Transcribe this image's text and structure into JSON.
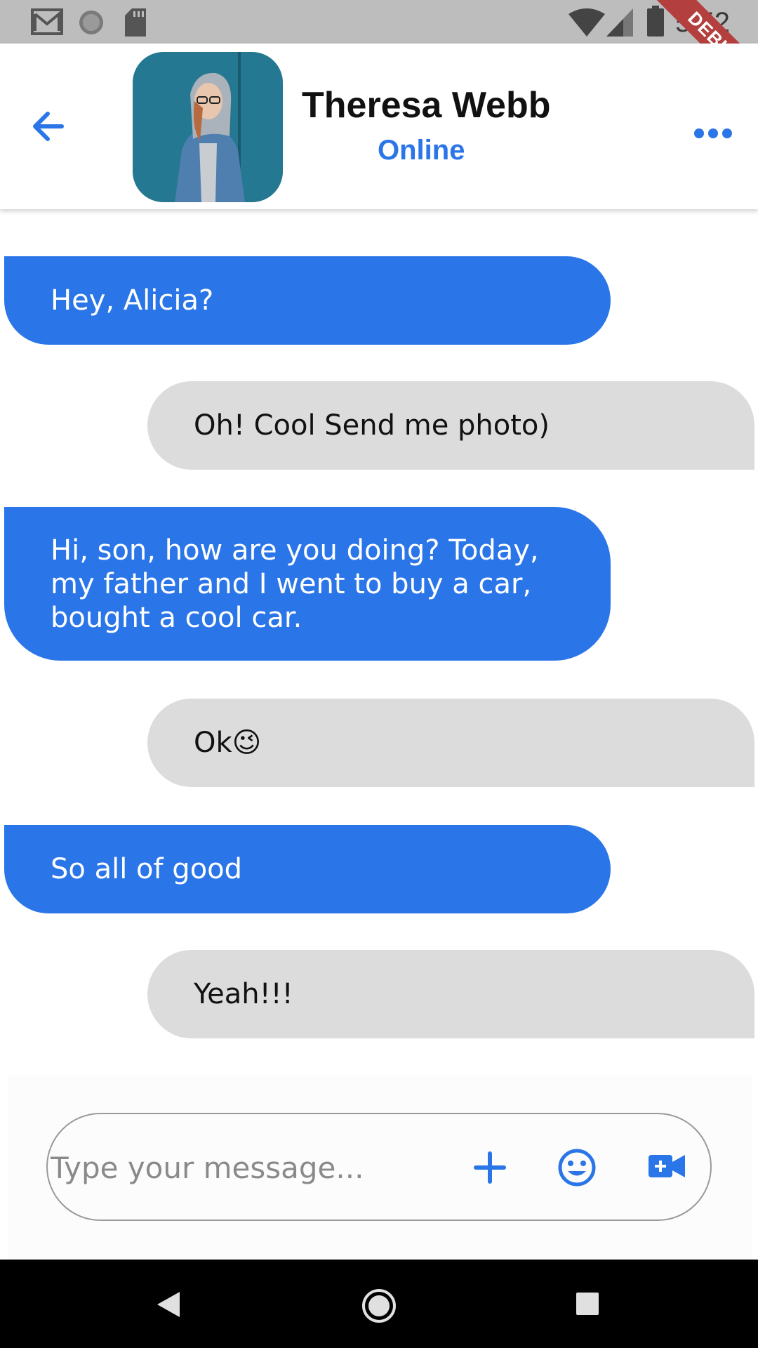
{
  "status_bar": {
    "time": "5:52",
    "icons": [
      "gmail-icon",
      "sync-icon",
      "sd-card-icon",
      "wifi-icon",
      "signal-icon",
      "battery-icon"
    ]
  },
  "debug_ribbon": "DEBUG",
  "header": {
    "contact_name": "Theresa Webb",
    "contact_status": "Online",
    "back_icon": "arrow-back-icon",
    "more_icon": "more-horiz-icon"
  },
  "messages": [
    {
      "direction": "incoming",
      "text": "Hey, Alicia?"
    },
    {
      "direction": "outgoing",
      "text": "Oh! Cool Send me photo)"
    },
    {
      "direction": "incoming",
      "text": "Hi, son, how are you doing? Today, my father and I went to buy a car, bought a cool car."
    },
    {
      "direction": "outgoing",
      "text": "Ok😉"
    },
    {
      "direction": "incoming",
      "text": "So all of good"
    },
    {
      "direction": "outgoing",
      "text": "Yeah!!!"
    }
  ],
  "composer": {
    "placeholder": "Type your message...",
    "value": "",
    "icons": [
      "add-icon",
      "emoji-icon",
      "video-call-icon"
    ]
  },
  "navigation_bar": [
    "back-nav-icon",
    "home-nav-icon",
    "recents-nav-icon"
  ],
  "colors": {
    "accent": "#2a75e8",
    "incoming_bubble": "#2a75e8",
    "outgoing_bubble": "#dcdcdc",
    "status_bar": "#bdbdbd",
    "nav_bar": "#000000"
  }
}
